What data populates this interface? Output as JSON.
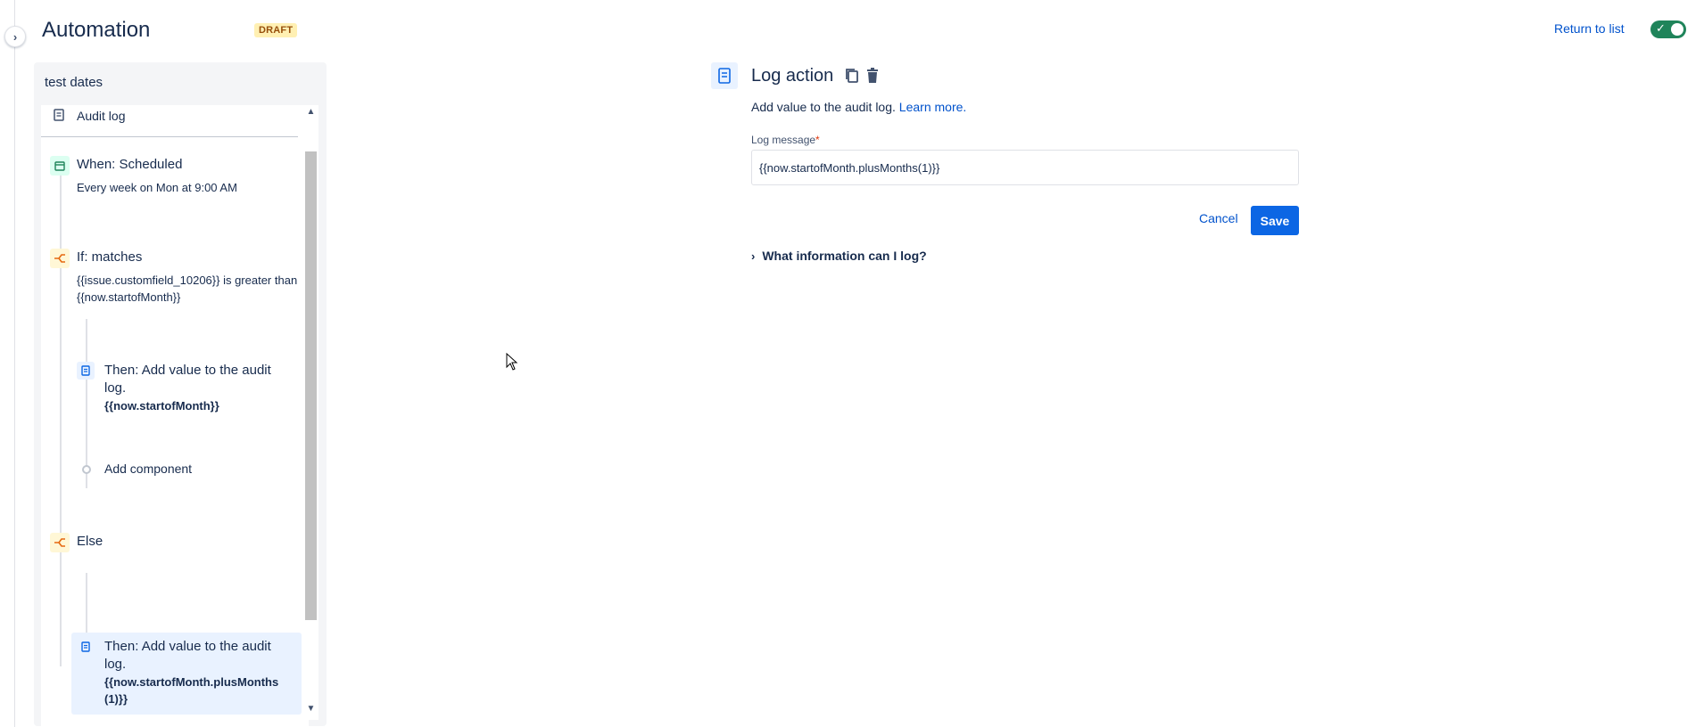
{
  "header": {
    "title": "Automation",
    "status_badge": "DRAFT",
    "return_link": "Return to list",
    "rule_enabled": true
  },
  "rule": {
    "name": "test dates",
    "audit_log_label": "Audit log",
    "trigger": {
      "title": "When: Scheduled",
      "description": "Every week on Mon at 9:00 AM"
    },
    "condition": {
      "title": "If: matches",
      "description": "{{issue.customfield_10206}} is greater than {{now.startofMonth}}"
    },
    "then_action": {
      "title": "Then: Add value to the audit log.",
      "value": "{{now.startofMonth}}"
    },
    "add_component_label": "Add component",
    "else_label": "Else",
    "else_action": {
      "title": "Then: Add value to the audit log.",
      "value": "{{now.startofMonth.plusMonths(1)}}"
    }
  },
  "editor": {
    "title": "Log action",
    "description": "Add value to the audit log.",
    "learn_more": "Learn more.",
    "field_label": "Log message",
    "required_marker": "*",
    "field_value": "{{now.startofMonth.plusMonths(1)}}",
    "cancel_label": "Cancel",
    "save_label": "Save",
    "info_expander": "What information can I log?"
  },
  "colors": {
    "accent": "#0c66e4",
    "link": "#0052cc",
    "toggle_on": "#1f845a",
    "selected_bg": "#e9f2ff",
    "draft_bg": "#fff0b3"
  },
  "icons": [
    "chevron-right-icon",
    "check-icon",
    "log-icon",
    "calendar-icon",
    "branch-icon",
    "copy-icon",
    "trash-icon",
    "chevron-up-icon",
    "chevron-down-icon",
    "mouse-cursor-icon"
  ]
}
